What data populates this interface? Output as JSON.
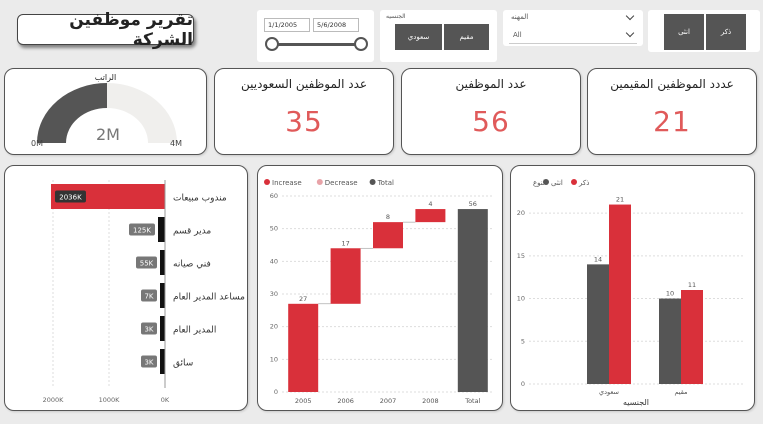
{
  "report_title": "تقرير موظفين الشركة",
  "date_slicer": {
    "start": "1/1/2005",
    "end": "5/6/2008"
  },
  "nationality_slicer": {
    "header": "الجنسيه",
    "options": [
      "مقيم",
      "سعودي"
    ]
  },
  "job_slicer": {
    "header": "المهنه",
    "value": "All"
  },
  "gender_slicer": {
    "options": [
      "انثى",
      "ذكر"
    ]
  },
  "kpis": {
    "saudi": {
      "title": "عدد الموظفين السعوديين",
      "value": "35"
    },
    "total": {
      "title": "عدد الموظفين",
      "value": "56"
    },
    "residents": {
      "title": "عددد الموظفين المقيمين",
      "value": "21"
    }
  },
  "gauge": {
    "title": "الراتب",
    "value_label": "2M",
    "min_label": "0M",
    "max_label": "4M",
    "fill_fraction": 0.5
  },
  "colors": {
    "red": "#d9303a",
    "dark": "#555555",
    "pink": "#e8a3a8",
    "kpi": "#e05a5a"
  },
  "chart_data": [
    {
      "type": "bar",
      "orientation": "horizontal",
      "categories": [
        "مندوب مبيعات",
        "مدير قسم",
        "فني صيانه",
        "مساعد المدير العام",
        "المدير العام",
        "سائق"
      ],
      "values": [
        2036,
        125,
        55,
        7,
        3,
        3
      ],
      "value_labels": [
        "2036K",
        "125K",
        "55K",
        "7K",
        "3K",
        "3K"
      ],
      "xticks": [
        "2000K",
        "1000K",
        "0K"
      ],
      "xlim": [
        0,
        2000
      ],
      "reversed_x": true
    },
    {
      "type": "bar",
      "subtype": "waterfall",
      "categories": [
        "2005",
        "2006",
        "2007",
        "2008",
        "Total"
      ],
      "values": [
        27,
        17,
        8,
        4,
        56
      ],
      "legend": [
        "Increase",
        "Decrease",
        "Total"
      ],
      "ylim": [
        0,
        60
      ],
      "yticks": [
        0,
        10,
        20,
        30,
        40,
        50,
        60
      ]
    },
    {
      "type": "bar",
      "categories": [
        "سعودي",
        "مقيم"
      ],
      "xlabel": "الجنسيه",
      "legend_title": "النوع",
      "series": [
        {
          "name": "انثى",
          "values": [
            14,
            10
          ]
        },
        {
          "name": "ذكر",
          "values": [
            21,
            11
          ]
        }
      ],
      "ylim": [
        0,
        22
      ],
      "yticks": [
        0,
        5,
        10,
        15,
        20
      ]
    }
  ]
}
